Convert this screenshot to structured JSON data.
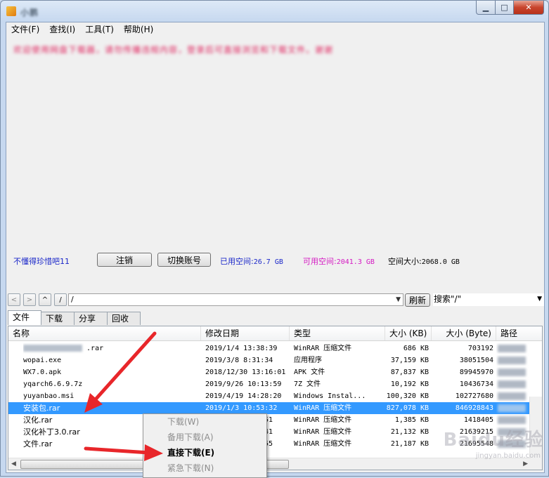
{
  "window": {
    "title": "小鹏"
  },
  "menu": [
    {
      "label": "文件(F)"
    },
    {
      "label": "查找(I)"
    },
    {
      "label": "工具(T)"
    },
    {
      "label": "帮助(H)"
    }
  ],
  "message": {
    "text": "欢迎使用网盘下载器，请勿传播违规内容，登录后可直接浏览和下载文件。谢谢"
  },
  "account": {
    "username": "不懂得珍惜吧11",
    "logout_label": "注销",
    "switch_label": "切换账号",
    "used_label": "已用空间:",
    "used_value": "26.7 GB",
    "available_label": "可用空间:",
    "available_value": "2041.3 GB",
    "total_label": "空间大小:",
    "total_value": "2068.0 GB"
  },
  "pathbar": {
    "up_label": "^",
    "root_label": "/",
    "path_value": "/",
    "refresh_label": "刷新",
    "search_value": "搜索\"/\""
  },
  "tabs": [
    {
      "label": "文件"
    },
    {
      "label": "下载"
    },
    {
      "label": "分享"
    },
    {
      "label": "回收站"
    }
  ],
  "list": {
    "columns": {
      "name": "名称",
      "modified": "修改日期",
      "type": "类型",
      "size_kb": "大小 (KB)",
      "size_byte": "大小 (Byte)",
      "path": "路径"
    },
    "rows": [
      {
        "name": ".rar",
        "modified": "2019/1/4 13:38:39",
        "type": "WinRAR 压缩文件",
        "size_kb": "686 KB",
        "size_byte": "703192"
      },
      {
        "name": "wopai.exe",
        "modified": "2019/3/8 8:31:34",
        "type": "应用程序",
        "size_kb": "37,159 KB",
        "size_byte": "38051504"
      },
      {
        "name": "WX7.0.apk",
        "modified": "2018/12/30 13:16:01",
        "type": "APK 文件",
        "size_kb": "87,837 KB",
        "size_byte": "89945970"
      },
      {
        "name": "yqarch6.6.9.7z",
        "modified": "2019/9/26 10:13:59",
        "type": "7Z 文件",
        "size_kb": "10,192 KB",
        "size_byte": "10436734"
      },
      {
        "name": "yuyanbao.msi",
        "modified": "2019/4/19 14:28:20",
        "type": "Windows Instal...",
        "size_kb": "100,320 KB",
        "size_byte": "102727680"
      },
      {
        "name": "安装包.rar",
        "modified": "2019/1/3 10:53:32",
        "type": "WinRAR 压缩文件",
        "size_kb": "827,078 KB",
        "size_byte": "846928843",
        "selected": true
      },
      {
        "name": "汉化.rar",
        "modified": "51",
        "type": "WinRAR 压缩文件",
        "size_kb": "1,385 KB",
        "size_byte": "1418405"
      },
      {
        "name": "汉化补丁3.0.rar",
        "modified": "41",
        "type": "WinRAR 压缩文件",
        "size_kb": "21,132 KB",
        "size_byte": "21639215"
      },
      {
        "name": "文件.rar",
        "modified": "55",
        "type": "WinRAR 压缩文件",
        "size_kb": "21,187 KB",
        "size_byte": "21695548"
      }
    ]
  },
  "context_menu": {
    "items": [
      {
        "label": "下载(W)",
        "state": "disabled"
      },
      {
        "label": "备用下载(A)",
        "state": "disabled"
      },
      {
        "label": "直接下载(E)",
        "state": "enabled"
      },
      {
        "label": "紧急下载(N)",
        "state": "disabled"
      }
    ]
  },
  "watermark": {
    "text": "Baidu经验",
    "sub": "jingyan.baidu.com"
  },
  "colors": {
    "selection": "#3399ff",
    "arrow": "#e8262a",
    "used": "#1a27c9",
    "available": "#d419c2"
  }
}
